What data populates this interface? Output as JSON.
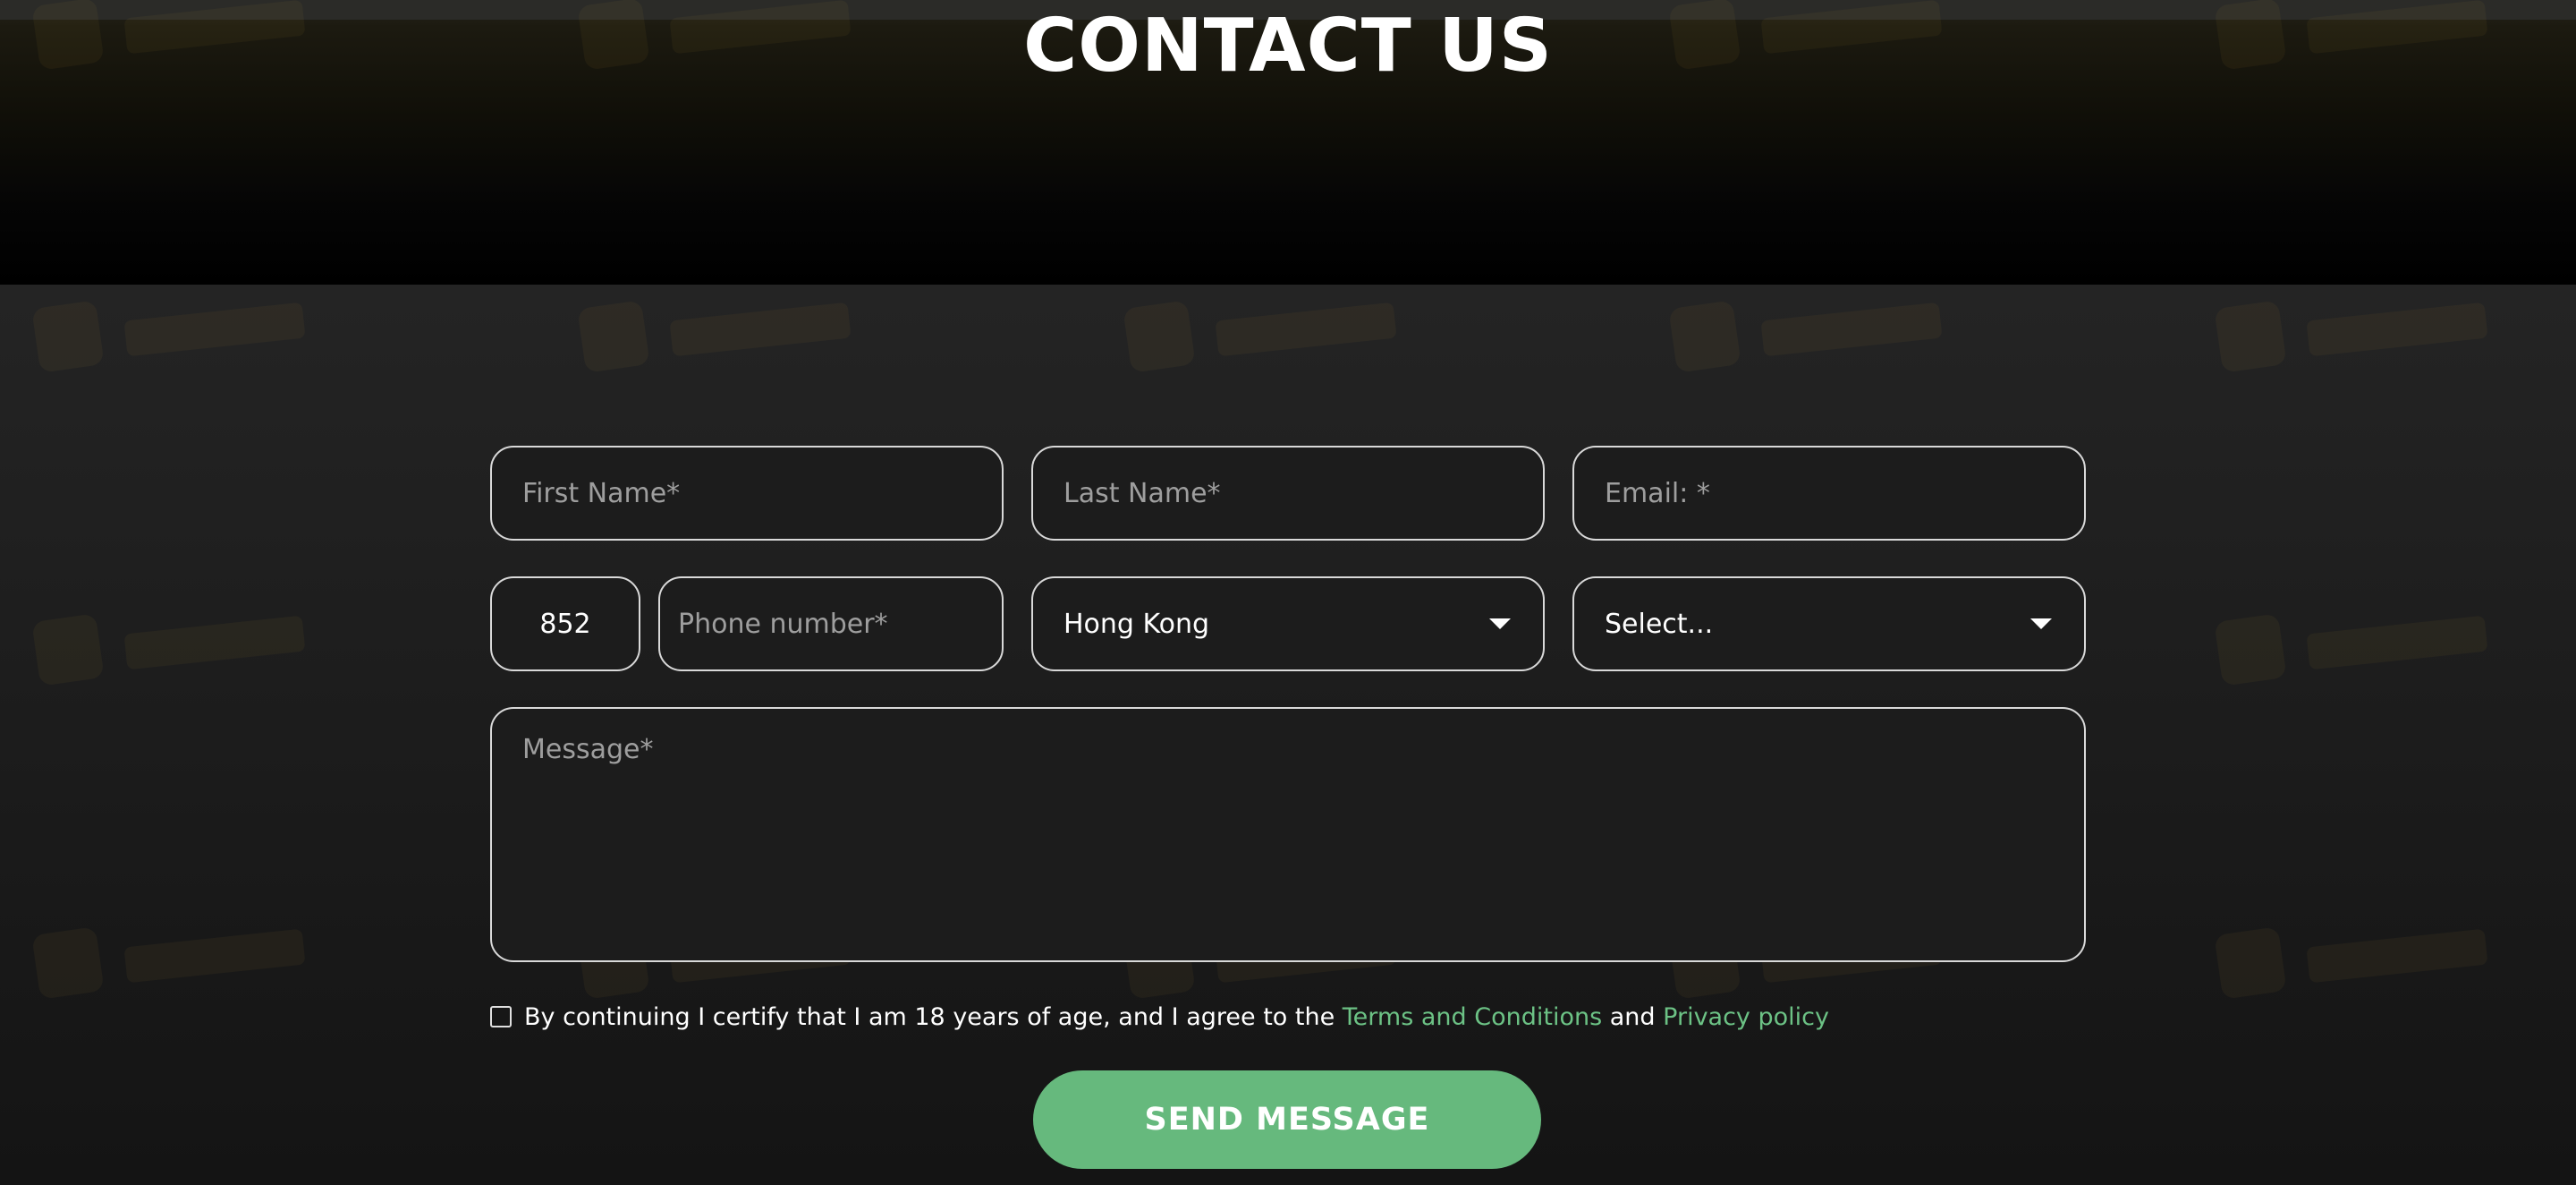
{
  "header": {
    "title": "CONTACT US"
  },
  "form": {
    "first_name": {
      "placeholder": "First Name*"
    },
    "last_name": {
      "placeholder": "Last Name*"
    },
    "email": {
      "placeholder": "Email: *"
    },
    "phone_code": {
      "value": "852"
    },
    "phone_number": {
      "placeholder": "Phone number*"
    },
    "country": {
      "selected": "Hong Kong"
    },
    "extra_select": {
      "selected": "Select..."
    },
    "message": {
      "placeholder": "Message*"
    },
    "consent": {
      "text_before": "By continuing I certify that I am 18 years of age, and I agree to the",
      "terms_link": "Terms and Conditions",
      "and_text": "and",
      "privacy_link": "Privacy policy",
      "checked": false
    },
    "submit_label": "SEND MESSAGE"
  },
  "colors": {
    "accent": "#66b97d",
    "link": "#6cc285",
    "field_border": "#d9d9d9",
    "background": "#1e1e1e"
  },
  "icons": {
    "dropdown": "chevron-down-icon",
    "checkbox": "checkbox-icon",
    "watermark": "watermark-logo-icon"
  }
}
